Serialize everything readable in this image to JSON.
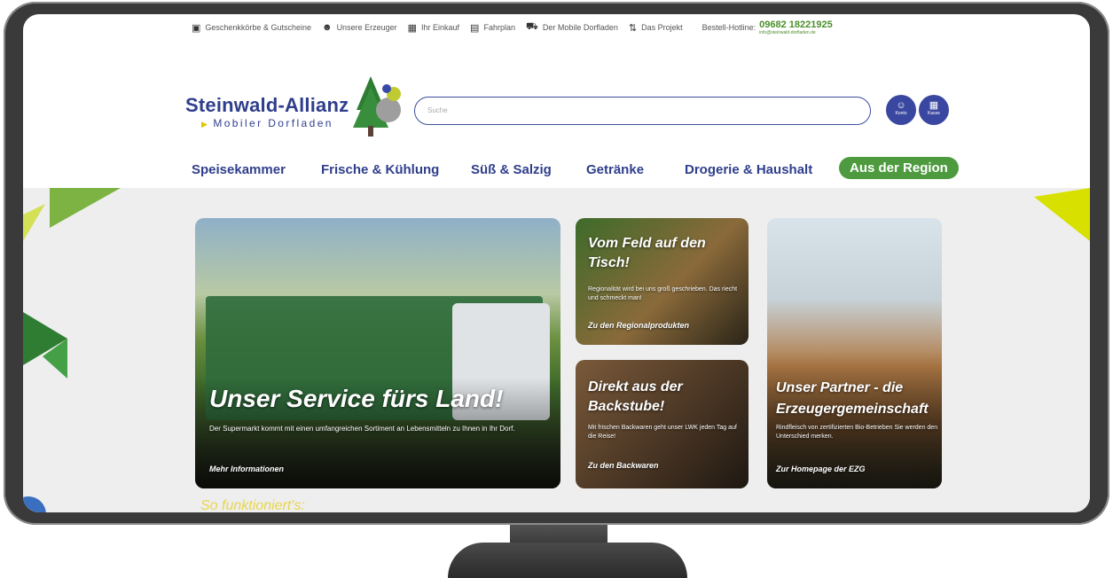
{
  "topbar": {
    "links": [
      {
        "label": "Geschenkkörbe & Gutscheine",
        "icon": "gift-basket-icon"
      },
      {
        "label": "Unsere Erzeuger",
        "icon": "people-icon"
      },
      {
        "label": "Ihr Einkauf",
        "icon": "basket-icon"
      },
      {
        "label": "Fahrplan",
        "icon": "schedule-icon"
      },
      {
        "label": "Der Mobile Dorfladen",
        "icon": "truck-icon"
      },
      {
        "label": "Das Projekt",
        "icon": "handshake-icon"
      }
    ],
    "hotline_label": "Bestell-Hotline:",
    "hotline_number": "09682 18221925",
    "hotline_email": "info@steinwald-dorfladen.de"
  },
  "logo": {
    "main": "Steinwald-Allianz",
    "sub": "Mobiler Dorfladen"
  },
  "search": {
    "placeholder": "Suche"
  },
  "buttons": {
    "account": "Konto",
    "cart": "Kasse"
  },
  "nav": {
    "items": [
      "Speisekammer",
      "Frische & Kühlung",
      "Süß & Salzig",
      "Getränke",
      "Drogerie & Haushalt"
    ],
    "highlight": "Aus der Region"
  },
  "cards": {
    "service": {
      "title": "Unser Service fürs Land!",
      "text": "Der Supermarkt kommt mit einen umfangreichen Sortiment an Lebensmitteln zu Ihnen in Ihr Dorf.",
      "cta": "Mehr Informationen"
    },
    "feld": {
      "title": "Vom Feld auf den Tisch!",
      "text": "Regionalität wird bei uns groß geschrieben. Das riecht und schmeckt man!",
      "cta": "Zu den Regionalprodukten"
    },
    "backstube": {
      "title": "Direkt aus der Backstube!",
      "text": "Mit frischen Backwaren geht unser LWK jeden Tag auf die Reise!",
      "cta": "Zu den Backwaren"
    },
    "partner": {
      "title": "Unser Partner - die Erzeugergemeinschaft",
      "text": "Rindfleisch von zertifizierten Bio-Betrieben Sie werden den Unterschied merken.",
      "cta": "Zur Homepage der EZG"
    }
  },
  "section": {
    "how": "So funktioniert's:"
  },
  "colors": {
    "brand_blue": "#2f3e8c",
    "brand_green": "#4e9a3f",
    "accent_yellow": "#d8e000"
  }
}
